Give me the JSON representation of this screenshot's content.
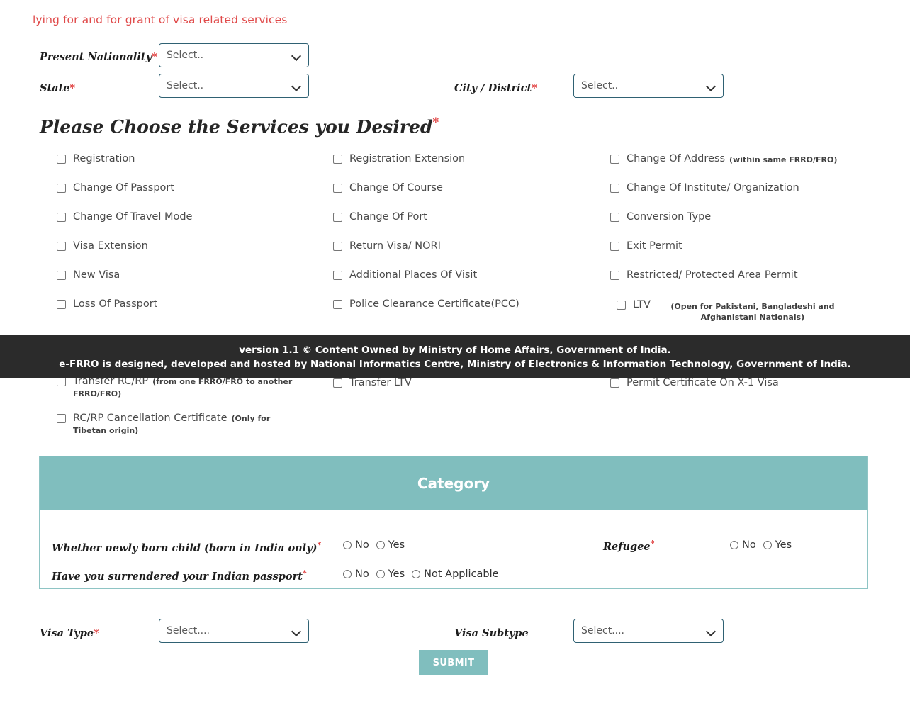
{
  "notice": "lying for and for grant of visa related services",
  "fields": {
    "present_nationality": {
      "label": "Present Nationality",
      "required": true,
      "value": "Select.."
    },
    "state": {
      "label": "State",
      "required": true,
      "value": "Select.."
    },
    "city_district": {
      "label": "City / District",
      "required": true,
      "value": "Select.."
    },
    "visa_type": {
      "label": "Visa Type",
      "required": true,
      "value": "Select...."
    },
    "visa_subtype": {
      "label": "Visa Subtype",
      "required": false,
      "value": "Select...."
    }
  },
  "services": {
    "heading": "Please Choose the Services you Desired",
    "heading_required": true,
    "col1": [
      {
        "label": "Registration",
        "note": "",
        "checked": false
      },
      {
        "label": "Change Of Passport",
        "note": "",
        "checked": false
      },
      {
        "label": "Change Of Travel Mode",
        "note": "",
        "checked": false
      },
      {
        "label": "Visa Extension",
        "note": "",
        "checked": false
      },
      {
        "label": "New Visa",
        "note": "",
        "checked": false
      },
      {
        "label": "Loss Of Passport",
        "note": "",
        "checked": false
      }
    ],
    "col2": [
      {
        "label": "Registration Extension",
        "note": "",
        "checked": false
      },
      {
        "label": "Change Of Course",
        "note": "",
        "checked": false
      },
      {
        "label": "Change Of Port",
        "note": "",
        "checked": false
      },
      {
        "label": "Return Visa/ NORI",
        "note": "",
        "checked": false
      },
      {
        "label": "Additional Places Of Visit",
        "note": "",
        "checked": false
      },
      {
        "label": "Police Clearance Certificate(PCC)",
        "note": "",
        "checked": false
      }
    ],
    "col3": [
      {
        "label": "Change Of Address",
        "note": "(within same FRRO/FRO)",
        "checked": false
      },
      {
        "label": "Change Of Institute/ Organization",
        "note": "",
        "checked": false
      },
      {
        "label": "Conversion Type",
        "note": "",
        "checked": false
      },
      {
        "label": "Exit Permit",
        "note": "",
        "checked": false
      },
      {
        "label": "Restricted/ Protected Area Permit",
        "note": "",
        "checked": false
      },
      {
        "label": "LTV",
        "note": "(Open for Pakistani, Bangladeshi and Afghanistani Nationals)",
        "checked": false
      }
    ],
    "row_behind_footer": [
      {
        "label": "Transfer RC/RP",
        "note": "(from one FRRO/FRO to another FRRO/FRO)",
        "checked": false
      },
      {
        "label": "Transfer LTV",
        "note": "",
        "checked": false
      },
      {
        "label": "Permit Certificate On X-1 Visa",
        "note": "",
        "checked": false
      }
    ],
    "last_row": [
      {
        "label": "RC/RP Cancellation Certificate",
        "note": "(Only for Tibetan origin)",
        "checked": false
      }
    ]
  },
  "category": {
    "title": "Category",
    "questions": [
      {
        "label": "Whether newly born child   (born in India only)",
        "required": true,
        "options": [
          "No",
          "Yes"
        ],
        "selected": null
      },
      {
        "label": "Have you surrendered your Indian passport",
        "required": true,
        "options": [
          "No",
          "Yes",
          "Not Applicable"
        ],
        "selected": null
      },
      {
        "label": "Refugee",
        "required": true,
        "options": [
          "No",
          "Yes"
        ],
        "selected": null
      }
    ]
  },
  "submit": {
    "label": "SUBMIT"
  },
  "footer": {
    "line1": "version 1.1 © Content Owned by Ministry of Home Affairs, Government of India.",
    "line2": "e-FRRO is designed, developed and hosted by National Informatics Centre, Ministry of Electronics & Information Technology, Government of India."
  },
  "colors": {
    "accent_teal": "#80bebe",
    "footer_bg": "#2b2b2b",
    "required_red": "#e03c3c",
    "notice_red": "#e04a4a",
    "select_border": "#2f6173"
  }
}
